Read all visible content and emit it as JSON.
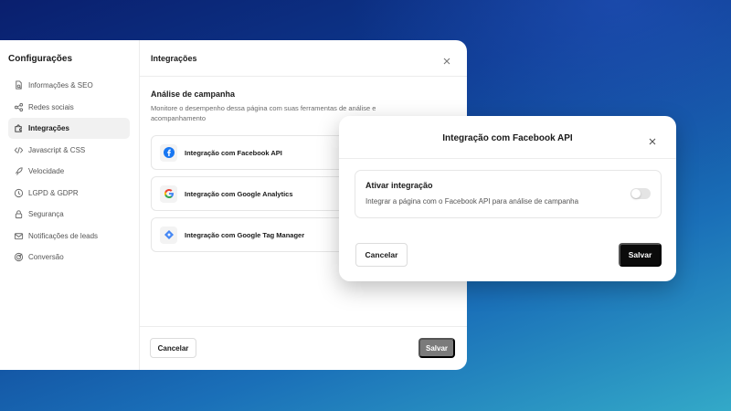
{
  "sidebar": {
    "title": "Configurações",
    "items": [
      {
        "label": "Informações & SEO",
        "icon": "document-search-icon"
      },
      {
        "label": "Redes sociais",
        "icon": "share-icon"
      },
      {
        "label": "Integrações",
        "icon": "puzzle-icon",
        "active": true
      },
      {
        "label": "Javascript & CSS",
        "icon": "code-icon"
      },
      {
        "label": "Velocidade",
        "icon": "rocket-icon"
      },
      {
        "label": "LGPD & GDPR",
        "icon": "shield-icon"
      },
      {
        "label": "Segurança",
        "icon": "lock-icon"
      },
      {
        "label": "Notificações de leads",
        "icon": "mail-icon"
      },
      {
        "label": "Conversão",
        "icon": "target-icon"
      }
    ]
  },
  "main": {
    "title": "Integrações",
    "section_title": "Análise de campanha",
    "section_description": "Monitore o desempenho dessa página com suas ferramentas de análise e acompanhamento",
    "integrations": [
      {
        "label": "Integração com Facebook API",
        "icon": "facebook-icon",
        "color": "#1877F2"
      },
      {
        "label": "Integração com Google Analytics",
        "icon": "google-icon",
        "color": "#4285F4"
      },
      {
        "label": "Integração com Google Tag Manager",
        "icon": "tag-manager-icon",
        "color": "#4285F4"
      }
    ],
    "footer": {
      "cancel_label": "Cancelar",
      "save_label": "Salvar"
    }
  },
  "modal": {
    "title": "Integração com Facebook API",
    "toggle_title": "Ativar integração",
    "toggle_description": "Integrar a página com o Facebook API para análise de campanha",
    "toggle_on": false,
    "cancel_label": "Cancelar",
    "save_label": "Salvar"
  },
  "colors": {
    "primary_button": "#0B0B0B",
    "disabled_button": "#7B7B7B",
    "active_item_bg": "#F1F1F1"
  }
}
